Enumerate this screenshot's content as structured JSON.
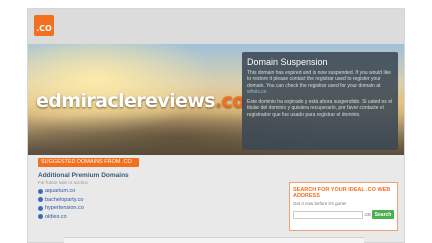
{
  "header": {
    "logo_text": ".CO"
  },
  "hero": {
    "domain_name": "edmiraclereviews",
    "domain_tld": ".co"
  },
  "suspension": {
    "heading": "Domain Suspension",
    "english_text": "This domain has expired and is now suspended. If you would like to restore it please contact the registrar used to register your domain. You can check the registrar used for your domain at ",
    "english_link": "whois.co",
    "spanish_text": "Este dominio ha expirado y está ahora suspendido. Si usted es el titular del dominio y quisiera recuperarlo, por favor contacte el registrador que fue usado para registrar el dominio."
  },
  "suggestions": {
    "tab_label": "SUGGESTED DOMAINS FROM .CO",
    "heading": "Additional Premium Domains",
    "subheading": "For future sale or auction",
    "items": [
      "aquarium.co",
      "bacheloparty.co",
      "hypertension.co",
      "oldies.co"
    ]
  },
  "search": {
    "heading": "SEARCH FOR YOUR IDEAL .CO WEB ADDRESS",
    "tagline": "Get it now before it's gone!",
    "tld_label": ".co",
    "button_label": "Search",
    "input_value": ""
  },
  "colors": {
    "accent": "#f37021",
    "panel": "#3a4854",
    "link": "#2c5aa0",
    "search_button": "#4caf50"
  }
}
